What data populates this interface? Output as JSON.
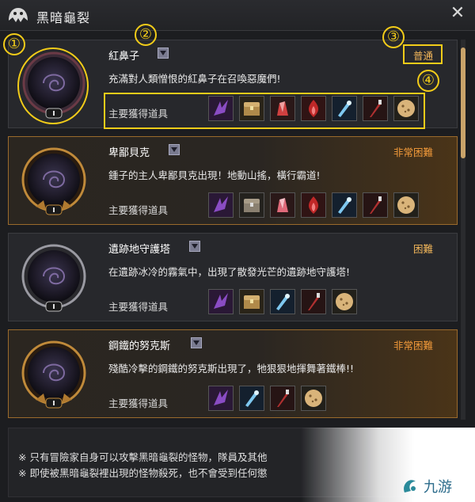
{
  "window": {
    "title": "黑暗龜裂",
    "close_glyph": "✕"
  },
  "colors": {
    "normal": "#f2b65a",
    "very_hard": "#f29a3a",
    "hard": "#f2b65a",
    "annotation": "#f2cc19"
  },
  "items_label": "主要獲得道具",
  "bosses": [
    {
      "name": "紅鼻子",
      "difficulty": "普通",
      "description": "充滿對人類憎恨的紅鼻子在召喚惡魔們!",
      "items": [
        "dark-claw-icon",
        "treasure-chest-icon",
        "red-crystal-icon",
        "red-flame-icon",
        "ice-shard-icon",
        "dagger-icon",
        "cookie-icon"
      ]
    },
    {
      "name": "卑鄙貝克",
      "difficulty": "非常困難",
      "description": "鍾子的主人卑鄙貝克出現！地動山搖，橫行霸道!",
      "items": [
        "dark-claw-icon",
        "treasure-chest-icon",
        "red-crystal-icon",
        "red-flame-icon",
        "ice-shard-icon",
        "dagger-icon",
        "cookie-icon"
      ]
    },
    {
      "name": "遺跡地守護塔",
      "difficulty": "困難",
      "description": "在遺跡冰冷的霧氣中，出現了散發光芒的遺跡地守護塔!",
      "items": [
        "dark-claw-icon",
        "treasure-chest-icon",
        "ice-shard-icon",
        "dagger-icon",
        "cookie-icon"
      ]
    },
    {
      "name": "鋼鐵的努克斯",
      "difficulty": "非常困難",
      "description": "殘酷冷擊的鋼鐵的努克斯出現了，牠狠狠地揮舞著鐵棒!!",
      "items": [
        "dark-claw-icon",
        "ice-shard-icon",
        "dagger-icon",
        "cookie-icon"
      ]
    }
  ],
  "notes": [
    "※ 只有冒險家自身可以攻擊黑暗龜裂的怪物，隊員及其他",
    "※ 即使被黑暗龜裂裡出現的怪物殺死，也不會受到任何懲"
  ],
  "annotations": [
    "①",
    "②",
    "③",
    "④"
  ],
  "watermark": "九游"
}
